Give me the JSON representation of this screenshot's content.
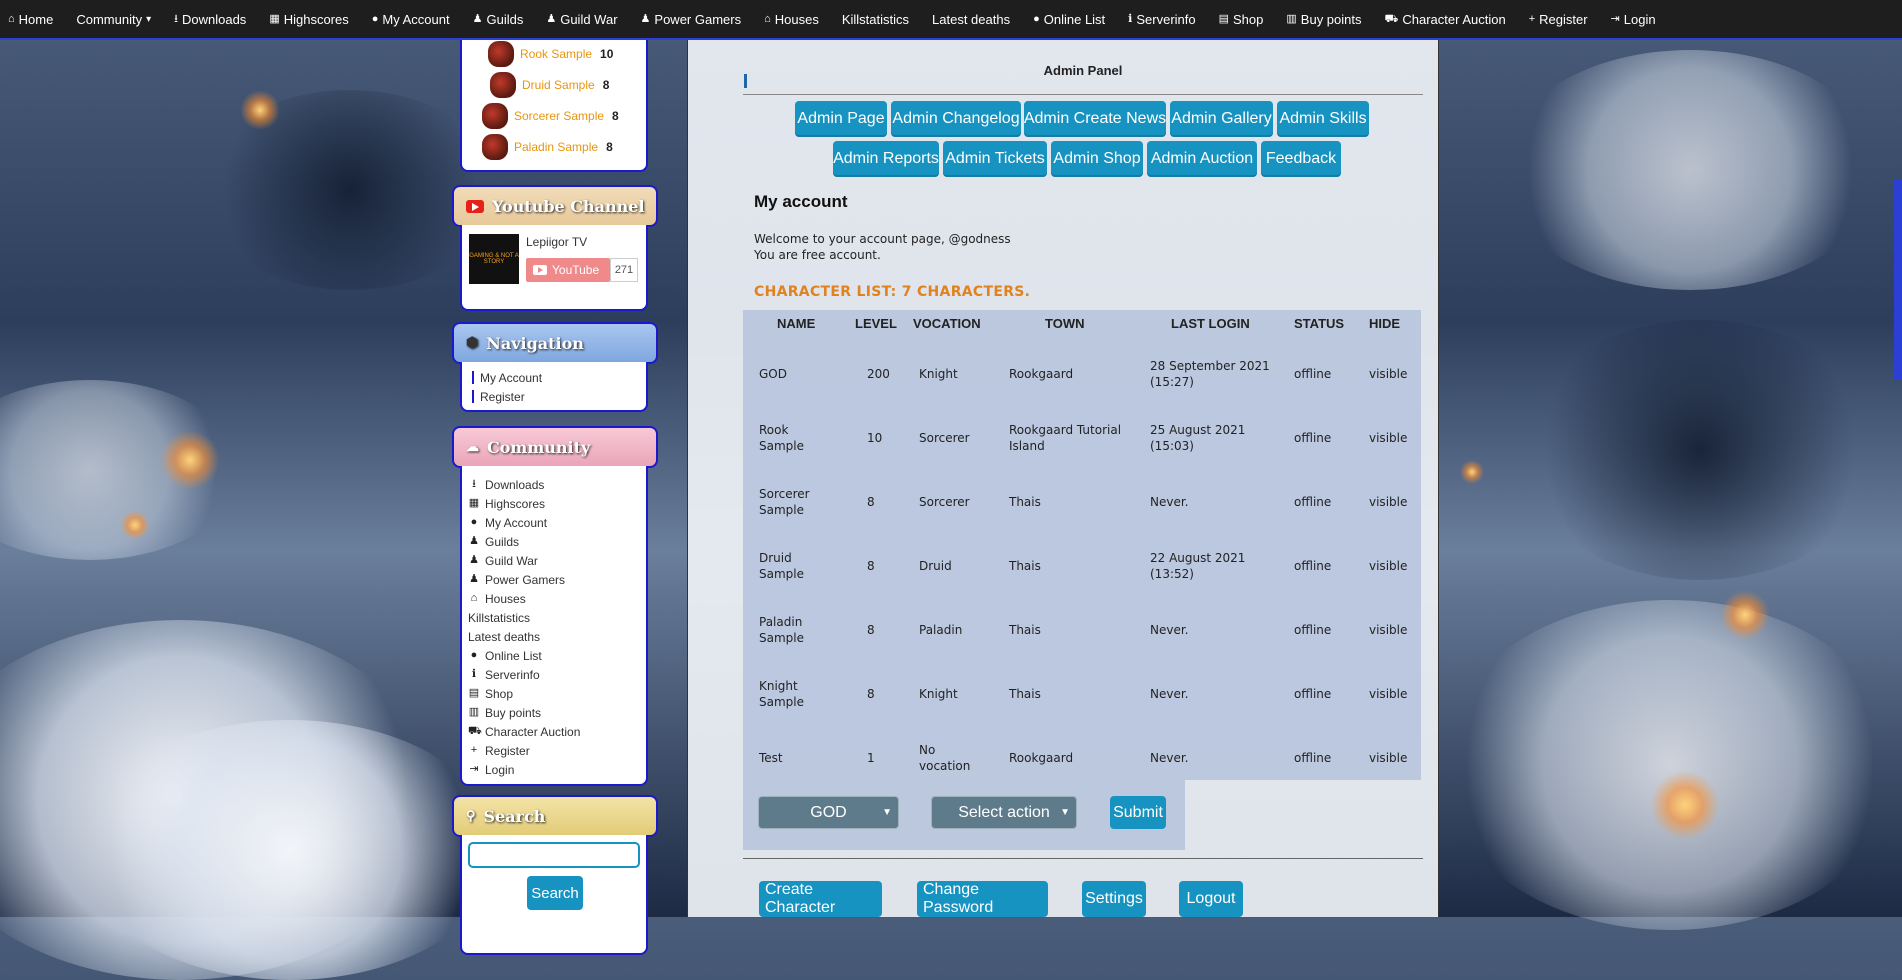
{
  "topnav": [
    {
      "icon": "⌂",
      "label": "Home"
    },
    {
      "icon": "",
      "label": "Community",
      "caret": "▾"
    },
    {
      "icon": "⭳",
      "label": "Downloads"
    },
    {
      "icon": "▦",
      "label": "Highscores"
    },
    {
      "icon": "●",
      "label": "My Account"
    },
    {
      "icon": "♟",
      "label": "Guilds"
    },
    {
      "icon": "♟",
      "label": "Guild War"
    },
    {
      "icon": "♟",
      "label": "Power Gamers"
    },
    {
      "icon": "⌂",
      "label": "Houses"
    },
    {
      "icon": "",
      "label": "Killstatistics"
    },
    {
      "icon": "",
      "label": "Latest deaths"
    },
    {
      "icon": "●",
      "label": "Online List"
    },
    {
      "icon": "ℹ",
      "label": "Serverinfo"
    },
    {
      "icon": "▤",
      "label": "Shop"
    },
    {
      "icon": "▥",
      "label": "Buy points"
    },
    {
      "icon": "⛟",
      "label": "Character Auction"
    },
    {
      "icon": "+",
      "label": "Register"
    },
    {
      "icon": "⇥",
      "label": "Login"
    }
  ],
  "top_chars": [
    {
      "name": "Rook Sample",
      "level": "10"
    },
    {
      "name": "Druid Sample",
      "level": "8"
    },
    {
      "name": "Sorcerer Sample",
      "level": "8"
    },
    {
      "name": "Paladin Sample",
      "level": "8"
    }
  ],
  "youtube": {
    "title": "Youtube Channel",
    "channel_name": "Lepiigor TV",
    "button_label": "YouTube",
    "subscriber_count": "271",
    "thumb_text": "GAMING & NOT A STORY"
  },
  "navigation": {
    "title": "Navigation",
    "links": [
      "My Account",
      "Register"
    ]
  },
  "community": {
    "title": "Community",
    "links": [
      {
        "icon": "⭳",
        "label": "Downloads"
      },
      {
        "icon": "▦",
        "label": "Highscores"
      },
      {
        "icon": "●",
        "label": "My Account"
      },
      {
        "icon": "♟",
        "label": "Guilds"
      },
      {
        "icon": "♟",
        "label": "Guild War"
      },
      {
        "icon": "♟",
        "label": "Power Gamers"
      },
      {
        "icon": "⌂",
        "label": "Houses"
      },
      {
        "icon": "",
        "label": "Killstatistics"
      },
      {
        "icon": "",
        "label": "Latest deaths"
      },
      {
        "icon": "●",
        "label": "Online List"
      },
      {
        "icon": "ℹ",
        "label": "Serverinfo"
      },
      {
        "icon": "▤",
        "label": "Shop"
      },
      {
        "icon": "▥",
        "label": "Buy points"
      },
      {
        "icon": "⛟",
        "label": "Character Auction"
      },
      {
        "icon": "+",
        "label": "Register"
      },
      {
        "icon": "⇥",
        "label": "Login"
      }
    ]
  },
  "search": {
    "title": "Search",
    "input_value": "",
    "button_label": "Search"
  },
  "admin": {
    "title": "Admin Panel",
    "buttons_row1": [
      "Admin Page",
      "Admin Changelog",
      "Admin Create News",
      "Admin Gallery",
      "Admin Skills"
    ],
    "buttons_row2": [
      "Admin Reports",
      "Admin Tickets",
      "Admin Shop",
      "Admin Auction",
      "Feedback"
    ]
  },
  "account": {
    "title": "My account",
    "welcome_line1": "Welcome to your account page, @godness",
    "welcome_line2": "You are free account.",
    "charlist_title": "CHARACTER LIST: 7 CHARACTERS."
  },
  "table": {
    "headers": [
      "NAME",
      "LEVEL",
      "VOCATION",
      "TOWN",
      "LAST LOGIN",
      "STATUS",
      "HIDE"
    ],
    "rows": [
      [
        "GOD",
        "200",
        "Knight",
        "Rookgaard",
        "28 September 2021 (15:27)",
        "offline",
        "visible"
      ],
      [
        "Rook Sample",
        "10",
        "Sorcerer",
        "Rookgaard Tutorial Island",
        "25 August 2021 (15:03)",
        "offline",
        "visible"
      ],
      [
        "Sorcerer Sample",
        "8",
        "Sorcerer",
        "Thais",
        "Never.",
        "offline",
        "visible"
      ],
      [
        "Druid Sample",
        "8",
        "Druid",
        "Thais",
        "22 August 2021 (13:52)",
        "offline",
        "visible"
      ],
      [
        "Paladin Sample",
        "8",
        "Paladin",
        "Thais",
        "Never.",
        "offline",
        "visible"
      ],
      [
        "Knight Sample",
        "8",
        "Knight",
        "Thais",
        "Never.",
        "offline",
        "visible"
      ],
      [
        "Test",
        "1",
        "No vocation",
        "Rookgaard",
        "Never.",
        "offline",
        "visible"
      ]
    ]
  },
  "actions": {
    "character_select": "GOD",
    "action_select": "Select action",
    "submit_label": "Submit"
  },
  "bottom_buttons": [
    "Create Character",
    "Change Password",
    "Settings",
    "Logout"
  ],
  "colors": {
    "accent": "#1793c1",
    "border": "#1a1acc",
    "orange": "#e0821e"
  }
}
